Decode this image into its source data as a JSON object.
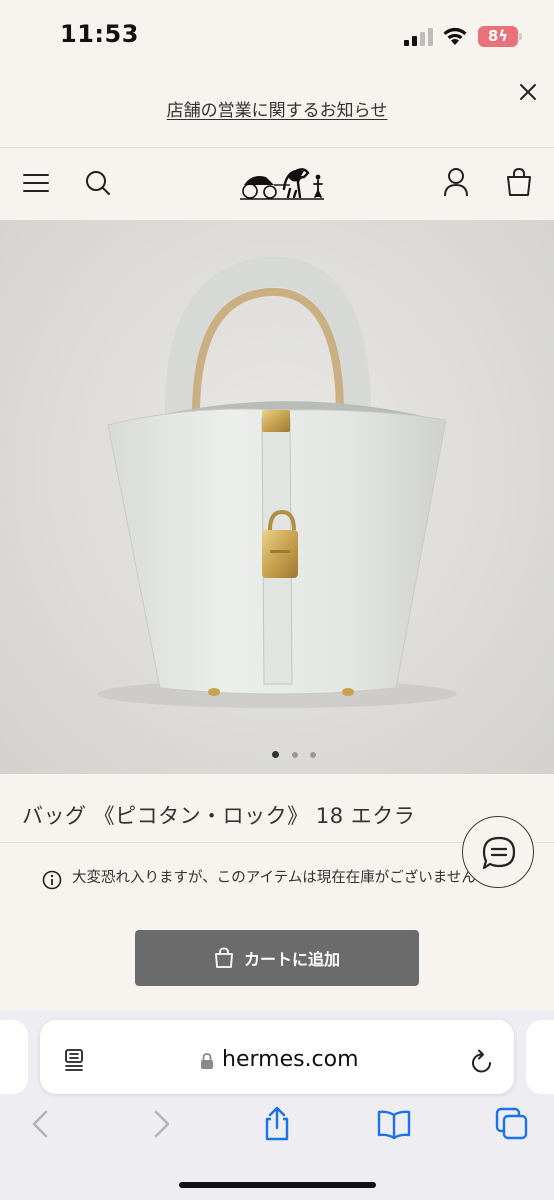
{
  "status_bar": {
    "time": "11:53",
    "battery": "8"
  },
  "notice": {
    "text": "店舗の営業に関するお知らせ"
  },
  "header": {
    "menu_icon": "hamburger-icon",
    "search_icon": "search-icon",
    "logo_icon": "carriage-logo-icon",
    "account_icon": "user-icon",
    "cart_icon": "shopping-bag-icon"
  },
  "product": {
    "title": "バッグ 《ピコタン・ロック》 18 エクラ",
    "stock_message": "大変恐れ入りますが、このアイテムは現在在庫がございません",
    "add_to_cart_label": "カートに追加",
    "image_count": 3,
    "active_image": 1
  },
  "safari": {
    "url": "hermes.com",
    "toolbar_icons": [
      "back-icon",
      "forward-icon",
      "share-icon",
      "bookmarks-icon",
      "tabs-icon"
    ]
  },
  "colors": {
    "background": "#f7f4ef",
    "button": "#6b6b6b",
    "battery": "#e8717a"
  }
}
